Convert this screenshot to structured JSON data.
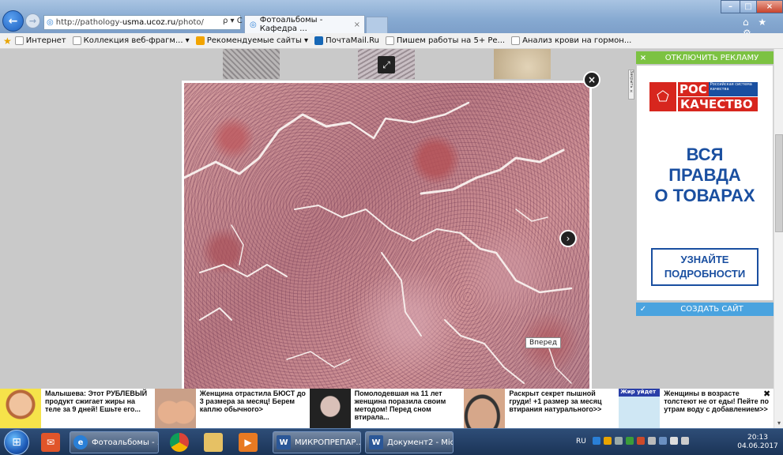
{
  "browser": {
    "address": {
      "prefix": "http://pathology-",
      "host": "usma.ucoz.ru",
      "path": "/photo/"
    },
    "address_tools": "ρ ▾ C",
    "tab": {
      "title": "Фотоальбомы - Кафедра ...",
      "close": "×"
    },
    "window_controls": {
      "minimize": "–",
      "maximize": "□",
      "close": "×"
    },
    "toolbar_icons": "⌂ ★ ⚙"
  },
  "favorites": [
    {
      "label": "Интернет",
      "icon": "page-icon"
    },
    {
      "label": "Коллекция веб-фрагм... ▾",
      "icon": "page-icon"
    },
    {
      "label": "Рекомендуемые сайты ▾",
      "icon": "bing-icon"
    },
    {
      "label": "ПочтаMail.Ru",
      "icon": "mail-icon"
    },
    {
      "label": "Пишем работы на 5+ Ре...",
      "icon": "page-icon"
    },
    {
      "label": "Анализ крови на гормон...",
      "icon": "page-icon"
    }
  ],
  "lightbox": {
    "close": "×",
    "next": "›",
    "expand": "⤢",
    "tooltip": "Вперед"
  },
  "ad": {
    "disable_x": "×",
    "disable_label": "ОТКЛЮЧИТЬ РЕКЛАМУ",
    "vertical_label": "Закрыть ×",
    "logo_top": "РОС",
    "logo_small": "Российская система качества",
    "logo_bottom": "КАЧЕСТВО",
    "headline_lines": [
      "ВСЯ",
      "ПРАВДА",
      "О ТОВАРАХ"
    ],
    "cta_lines": [
      "УЗНАЙТЕ",
      "ПОДРОБНОСТИ"
    ],
    "create_check": "✓",
    "create_label": "СОЗДАТЬ САЙТ"
  },
  "news": [
    {
      "text": "Малышева: Этот РУБЛЕВЫЙ продукт сжигает жиры на теле за 9 дней! Ешьте его..."
    },
    {
      "text": "Женщина отрастила БЮСТ до 3 размера за месяц! Берем каплю обычного>"
    },
    {
      "text": "Помолодевшая на 11 лет женщина поразила своим методом! Перед сном втирала..."
    },
    {
      "text": "Раскрыт секрет пышной груди! +1 размер за месяц втирания натурального>>"
    },
    {
      "text": "Женщины в возрасте толстеют не от еды! Пейте по утрам воду с добавлением>>",
      "badge": "Жир уйдет"
    }
  ],
  "news_close": "✖",
  "scroll_down": "▾",
  "taskbar": {
    "start": "⊞",
    "tasks": [
      {
        "id": "ie",
        "label": "Фотоальбомы - ...",
        "icon": "e"
      },
      {
        "id": "word1",
        "label": "МИКРОПРЕПАР...",
        "icon": "W"
      },
      {
        "id": "word2",
        "label": "Документ2 - Micr...",
        "icon": "W"
      }
    ],
    "lang": "RU",
    "time": "20:13",
    "date": "04.06.2017"
  }
}
